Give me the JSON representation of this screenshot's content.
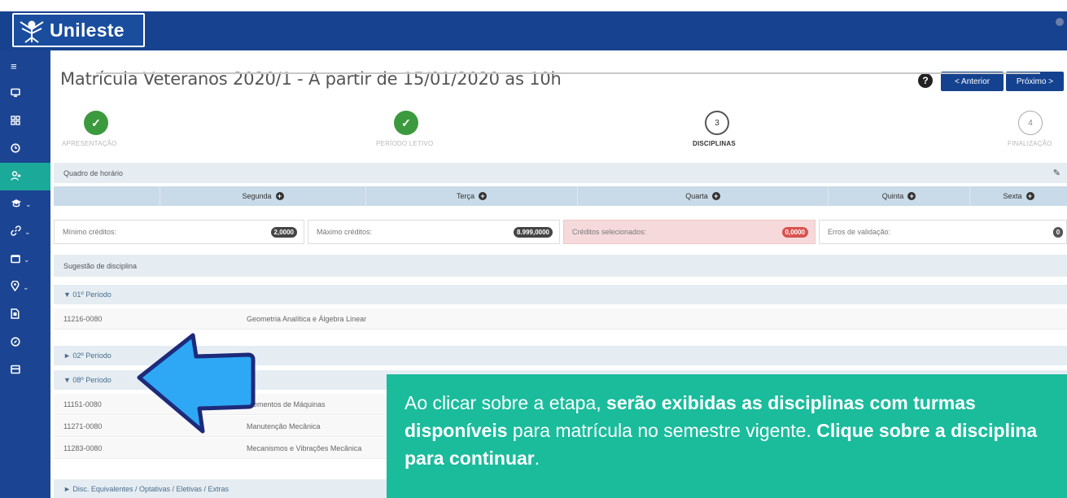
{
  "brand": {
    "name": "Unileste"
  },
  "sidebar": {
    "items": [
      {
        "icon": "menu-icon",
        "caret": false
      },
      {
        "icon": "monitor-icon",
        "caret": false
      },
      {
        "icon": "grid-icon",
        "caret": false
      },
      {
        "icon": "clock-icon",
        "caret": false
      },
      {
        "icon": "user-add-icon",
        "caret": false,
        "active": true
      },
      {
        "icon": "graduation-cap-icon",
        "caret": true
      },
      {
        "icon": "link-icon",
        "caret": true
      },
      {
        "icon": "folder-icon",
        "caret": true
      },
      {
        "icon": "location-pin-icon",
        "caret": true
      },
      {
        "icon": "document-icon",
        "caret": false
      },
      {
        "icon": "compass-icon",
        "caret": false
      },
      {
        "icon": "card-icon",
        "caret": false
      }
    ]
  },
  "header": {
    "title": "Matrícula Veteranos 2020/1 - A partir de 15/01/2020 as 10h",
    "prev_label": "< Anterior",
    "next_label": "Próximo >"
  },
  "steps": [
    {
      "label": "APRESENTAÇÃO",
      "state": "done",
      "number": "✓"
    },
    {
      "label": "PERÍODO LETIVO",
      "state": "done",
      "number": "✓"
    },
    {
      "label": "DISCIPLINAS",
      "state": "current",
      "number": "3"
    },
    {
      "label": "FINALIZAÇÃO",
      "state": "future",
      "number": "4"
    }
  ],
  "schedule": {
    "title": "Quadro de horário",
    "days": [
      "Segunda",
      "Terça",
      "Quarta",
      "Quinta",
      "Sexta"
    ]
  },
  "credits": {
    "min_label": "Mínimo créditos:",
    "min_value": "2,0000",
    "max_label": "Máximo créditos:",
    "max_value": "8.999,0000",
    "selected_label": "Créditos selecionados:",
    "selected_value": "0,0000",
    "errors_label": "Erros de validação:",
    "errors_value": "0"
  },
  "suggestion": {
    "title": "Sugestão de disciplina",
    "period_01": "▼ 01º Período",
    "period_01_rows": [
      {
        "code": "11216-0080",
        "name": "Geometria Analítica e Álgebra Linear"
      }
    ],
    "period_02": "► 02º Período",
    "period_08": "▼ 08º Período",
    "period_08_rows": [
      {
        "code": "11151-0080",
        "name": "Elementos de Máquinas"
      },
      {
        "code": "11271-0080",
        "name": "Manutenção Mecânica"
      },
      {
        "code": "11283-0080",
        "name": "Mecanismos e Vibrações Mecânica"
      }
    ],
    "extras": "► Disc. Equivalentes / Optativas / Eletivas / Extras"
  },
  "callout": {
    "t1": "Ao clicar sobre a etapa, ",
    "b1": "serão exibidas as disciplinas com turmas disponíveis",
    "t2": " para matrícula no semestre vigente. ",
    "b2": "Clique sobre a disciplina para continuar",
    "t3": "."
  },
  "colors": {
    "brand_blue": "#16428f",
    "sidebar_active": "#1ba99a",
    "step_done": "#3c9a3e",
    "callout_bg": "#1abc9c",
    "arrow_fill": "#2ea8f5"
  }
}
